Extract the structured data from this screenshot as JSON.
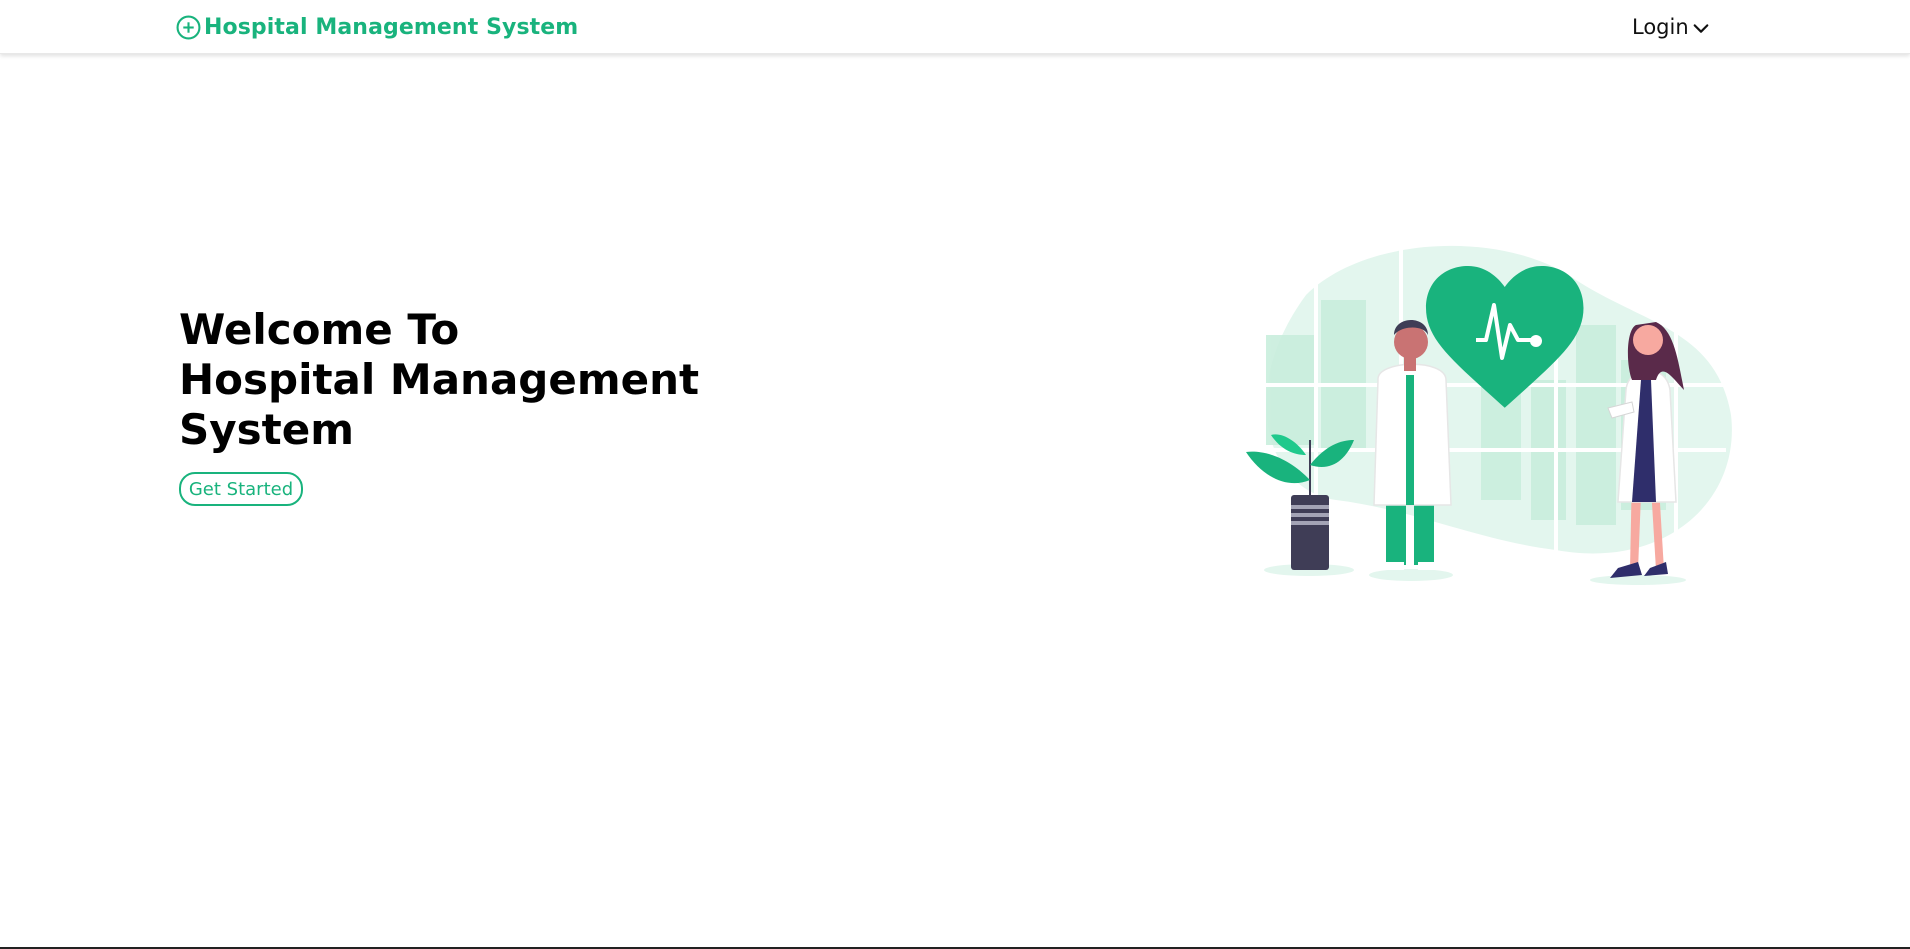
{
  "navbar": {
    "brand_icon": "plus-circle-icon",
    "brand_text": "Hospital Management System",
    "login_label": "Login",
    "login_icon": "chevron-down-icon"
  },
  "hero": {
    "title_lines": [
      "Welcome To",
      "Hospital Management",
      "System"
    ],
    "cta_label": "Get Started"
  },
  "illustration": {
    "subject": "doctors-heartbeat-illustration",
    "icon": "heart-pulse-icon"
  },
  "colors": {
    "accent": "#19b37d",
    "light_accent": "#e3f6ee",
    "text": "#000000",
    "background": "#ffffff"
  }
}
